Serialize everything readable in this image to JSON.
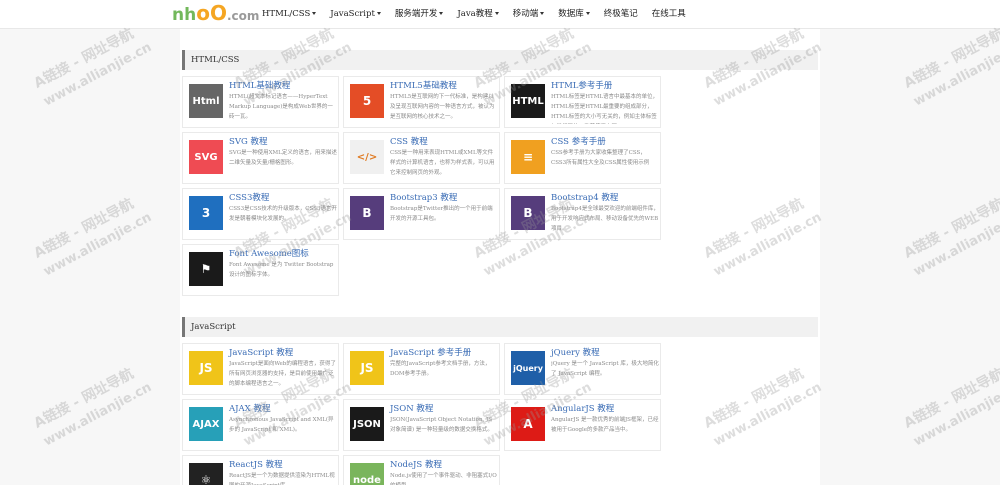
{
  "logo": {
    "part1": "nh",
    "part2": "oO",
    "part3": ".com"
  },
  "nav": [
    {
      "label": "HTML/CSS",
      "dropdown": true
    },
    {
      "label": "JavaScript",
      "dropdown": true
    },
    {
      "label": "服务端开发",
      "dropdown": true
    },
    {
      "label": "Java教程",
      "dropdown": true
    },
    {
      "label": "移动端",
      "dropdown": true
    },
    {
      "label": "数据库",
      "dropdown": true
    },
    {
      "label": "终极笔记",
      "dropdown": false
    },
    {
      "label": "在线工具",
      "dropdown": false
    }
  ],
  "sections": [
    {
      "title": "HTML/CSS",
      "cards": [
        {
          "title": "HTML基础教程",
          "desc": "HTML(超文本标记语言——HyperText Markup Language)是构成Web世界的一砖一瓦。",
          "icon": "html-icon",
          "icon_text": "Html",
          "color": "#666666"
        },
        {
          "title": "HTML5基础教程",
          "desc": "HTML5是互联网的下一代标准，是构建以及呈现互联网内容的一种语言方式，被认为是互联网的核心技术之一。",
          "icon": "html5-icon",
          "icon_text": "5",
          "color": "#e44d26"
        },
        {
          "title": "HTML参考手册",
          "desc": "HTML标签是HTML语言中最基本的单位，HTML标签是HTML最重要的组成部分，HTML标签的大小写无关的，例如主体标签与是相同的，推荐使用小写",
          "icon": "html-reference-icon",
          "icon_text": "HTML",
          "color": "#1a1a1a"
        },
        {
          "title": "SVG 教程",
          "desc": "SVG是一种使用XML定义的语言，用来描述二维矢量及矢量/栅格图形。",
          "icon": "svg-icon",
          "icon_text": "SVG",
          "color": "#ef4b53"
        },
        {
          "title": "CSS 教程",
          "desc": "CSS是一种用来表现HTML或XML等文件样式的计算机语言，也称为样式表，可以用它来控制网页的外观。",
          "icon": "css-icon",
          "icon_text": "</>",
          "color": "#f0f0f0"
        },
        {
          "title": "CSS 参考手册",
          "desc": "CSS参考手册为大家收集整理了CSS，CSS3所有属性大全及CSS属性使用示例",
          "icon": "css-reference-icon",
          "icon_text": "≡",
          "color": "#f0a020"
        },
        {
          "title": "CSS3教程",
          "desc": "CSS3是CSS技术的升级版本，CSS3语言开发是朝着模块化发展的。",
          "icon": "css3-icon",
          "icon_text": "3",
          "color": "#1f6fbf"
        },
        {
          "title": "Bootstrap3 教程",
          "desc": "Bootstrap是Twitter推出的一个用于前端开发的开源工具包。",
          "icon": "bootstrap3-icon",
          "icon_text": "B",
          "color": "#563d7c"
        },
        {
          "title": "Bootstrap4 教程",
          "desc": "Bootstrap4是全球最受欢迎的前端组件库，用于开发响应式布局、移动设备优先的WEB项目。",
          "icon": "bootstrap4-icon",
          "icon_text": "B",
          "color": "#563d7c"
        },
        {
          "title": "Font Awesome图标",
          "desc": "Font Awesome 是为 Twitter Bootstrap 设计的图标字体。",
          "icon": "font-awesome-icon",
          "icon_text": "⚑",
          "color": "#1a1a1a"
        }
      ]
    },
    {
      "title": "JavaScript",
      "cards": [
        {
          "title": "JavaScript 教程",
          "desc": "JavaScript是面向Web的编程语言，获得了所有网页浏览器的支持，是目前使用最广泛的脚本编程语言之一。",
          "icon": "javascript-icon",
          "icon_text": "JS",
          "color": "#f0c419"
        },
        {
          "title": "JavaScript 参考手册",
          "desc": "完整的JavaScript参考文档手册，方法，DOM参考手册。",
          "icon": "javascript-reference-icon",
          "icon_text": "JS",
          "color": "#f0c419"
        },
        {
          "title": "jQuery 教程",
          "desc": "jQuery 是一个 JavaScript 库，极大地简化了 JavaScript 编程。",
          "icon": "jquery-icon",
          "icon_text": "jQuery",
          "color": "#1f5fa8"
        },
        {
          "title": "AJAX 教程",
          "desc": "Asynchronous JavaScript and XML(异步的 JavaScript 和 XML)。",
          "icon": "ajax-icon",
          "icon_text": "AJAX",
          "color": "#27a0b8"
        },
        {
          "title": "JSON 教程",
          "desc": "JSON(JavaScript Object Notation, JS 对象简谱) 是一种轻量级的数据交换格式。",
          "icon": "json-icon",
          "icon_text": "JSON",
          "color": "#1a1a1a"
        },
        {
          "title": "AngularJS 教程",
          "desc": "AngularJS 是一款优秀的前端JS框架，已经被用于Google的多款产品当中。",
          "icon": "angularjs-icon",
          "icon_text": "A",
          "color": "#dd1b16"
        },
        {
          "title": "ReactJS 教程",
          "desc": "ReactJS是一个为数据提供渲染为HTML视图的开源JavaScript库。",
          "icon": "reactjs-icon",
          "icon_text": "⚛",
          "color": "#222222"
        },
        {
          "title": "NodeJS 教程",
          "desc": "Node.js使用了一个事件驱动、非阻塞式I/O的模型。",
          "icon": "nodejs-icon",
          "icon_text": "node",
          "color": "#7ab55c"
        }
      ]
    }
  ],
  "watermark": {
    "line1": "A链接 - 网址导航",
    "line2": "www.allianjie.cn"
  }
}
